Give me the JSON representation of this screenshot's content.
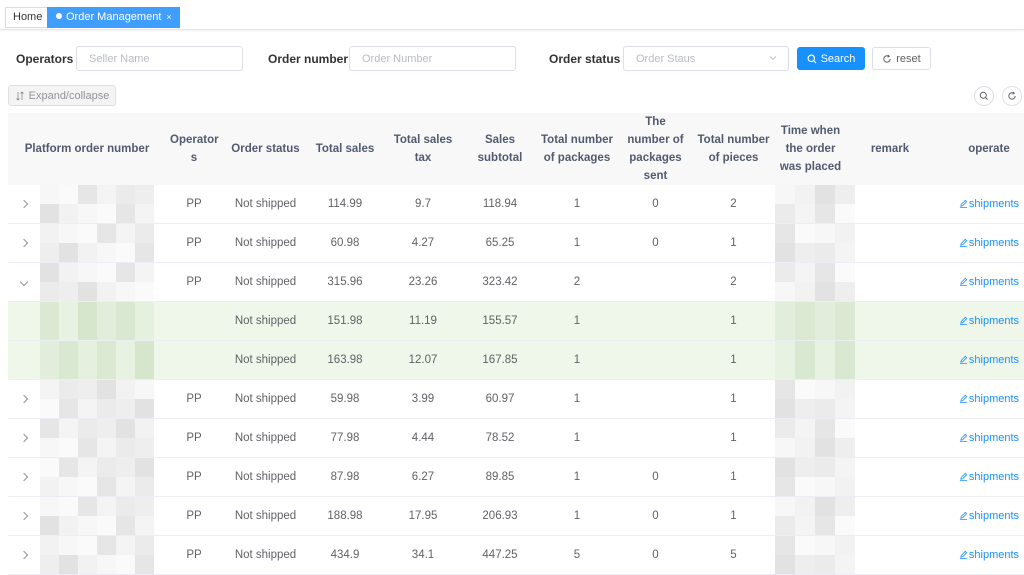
{
  "tabs": {
    "home": "Home",
    "active": "Order Management",
    "close": "×"
  },
  "filters": {
    "operators_label": "Operators",
    "seller_placeholder": "Seller Name",
    "order_number_label": "Order number",
    "order_number_placeholder": "Order Number",
    "order_status_label": "Order status",
    "order_status_placeholder": "Order Staus",
    "search_label": "Search",
    "reset_label": "reset"
  },
  "toolbar": {
    "expand_label": "Expand/collapse"
  },
  "table": {
    "headers": {
      "platform_order_number": "Platform order number",
      "operators": "Operator s",
      "order_status": "Order status",
      "total_sales": "Total sales",
      "total_sales_tax": "Total sales tax",
      "sales_subtotal": "Sales subtotal",
      "total_packages": "Total number of packages",
      "packages_sent": "The number of packages sent",
      "total_pieces": "Total number of pieces",
      "time_placed": "Time when the order was placed",
      "remark": "remark",
      "operate": "operate"
    },
    "action_label": "shipments",
    "rows": [
      {
        "kind": "parent",
        "toggle": "collapsed",
        "operator": "PP",
        "status": "Not shipped",
        "total_sales": "114.99",
        "tax": "9.7",
        "subtotal": "118.94",
        "packages": "1",
        "sent": "0",
        "pieces": "2"
      },
      {
        "kind": "parent",
        "toggle": "collapsed",
        "operator": "PP",
        "status": "Not shipped",
        "total_sales": "60.98",
        "tax": "4.27",
        "subtotal": "65.25",
        "packages": "1",
        "sent": "0",
        "pieces": "1"
      },
      {
        "kind": "parent",
        "toggle": "expanded",
        "operator": "PP",
        "status": "Not shipped",
        "total_sales": "315.96",
        "tax": "23.26",
        "subtotal": "323.42",
        "packages": "2",
        "sent": "",
        "pieces": "2"
      },
      {
        "kind": "child",
        "toggle": "none",
        "operator": "",
        "status": "Not shipped",
        "total_sales": "151.98",
        "tax": "11.19",
        "subtotal": "155.57",
        "packages": "1",
        "sent": "",
        "pieces": "1"
      },
      {
        "kind": "child",
        "toggle": "none",
        "operator": "",
        "status": "Not shipped",
        "total_sales": "163.98",
        "tax": "12.07",
        "subtotal": "167.85",
        "packages": "1",
        "sent": "",
        "pieces": "1"
      },
      {
        "kind": "parent",
        "toggle": "collapsed",
        "operator": "PP",
        "status": "Not shipped",
        "total_sales": "59.98",
        "tax": "3.99",
        "subtotal": "60.97",
        "packages": "1",
        "sent": "",
        "pieces": "1"
      },
      {
        "kind": "parent",
        "toggle": "collapsed",
        "operator": "PP",
        "status": "Not shipped",
        "total_sales": "77.98",
        "tax": "4.44",
        "subtotal": "78.52",
        "packages": "1",
        "sent": "",
        "pieces": "1"
      },
      {
        "kind": "parent",
        "toggle": "collapsed",
        "operator": "PP",
        "status": "Not shipped",
        "total_sales": "87.98",
        "tax": "6.27",
        "subtotal": "89.85",
        "packages": "1",
        "sent": "0",
        "pieces": "1"
      },
      {
        "kind": "parent",
        "toggle": "collapsed",
        "operator": "PP",
        "status": "Not shipped",
        "total_sales": "188.98",
        "tax": "17.95",
        "subtotal": "206.93",
        "packages": "1",
        "sent": "0",
        "pieces": "1"
      },
      {
        "kind": "parent",
        "toggle": "collapsed",
        "operator": "PP",
        "status": "Not shipped",
        "total_sales": "434.9",
        "tax": "34.1",
        "subtotal": "447.25",
        "packages": "5",
        "sent": "0",
        "pieces": "5"
      }
    ]
  },
  "icons": {
    "search": "search-icon",
    "reset": "refresh-icon",
    "expand": "sort-icon",
    "edit": "edit-icon",
    "chevron": "chevron-icon"
  },
  "colors": {
    "primary": "#1890ff",
    "child_row_bg": "#eef7e9",
    "header_bg": "#f8f8f9"
  }
}
